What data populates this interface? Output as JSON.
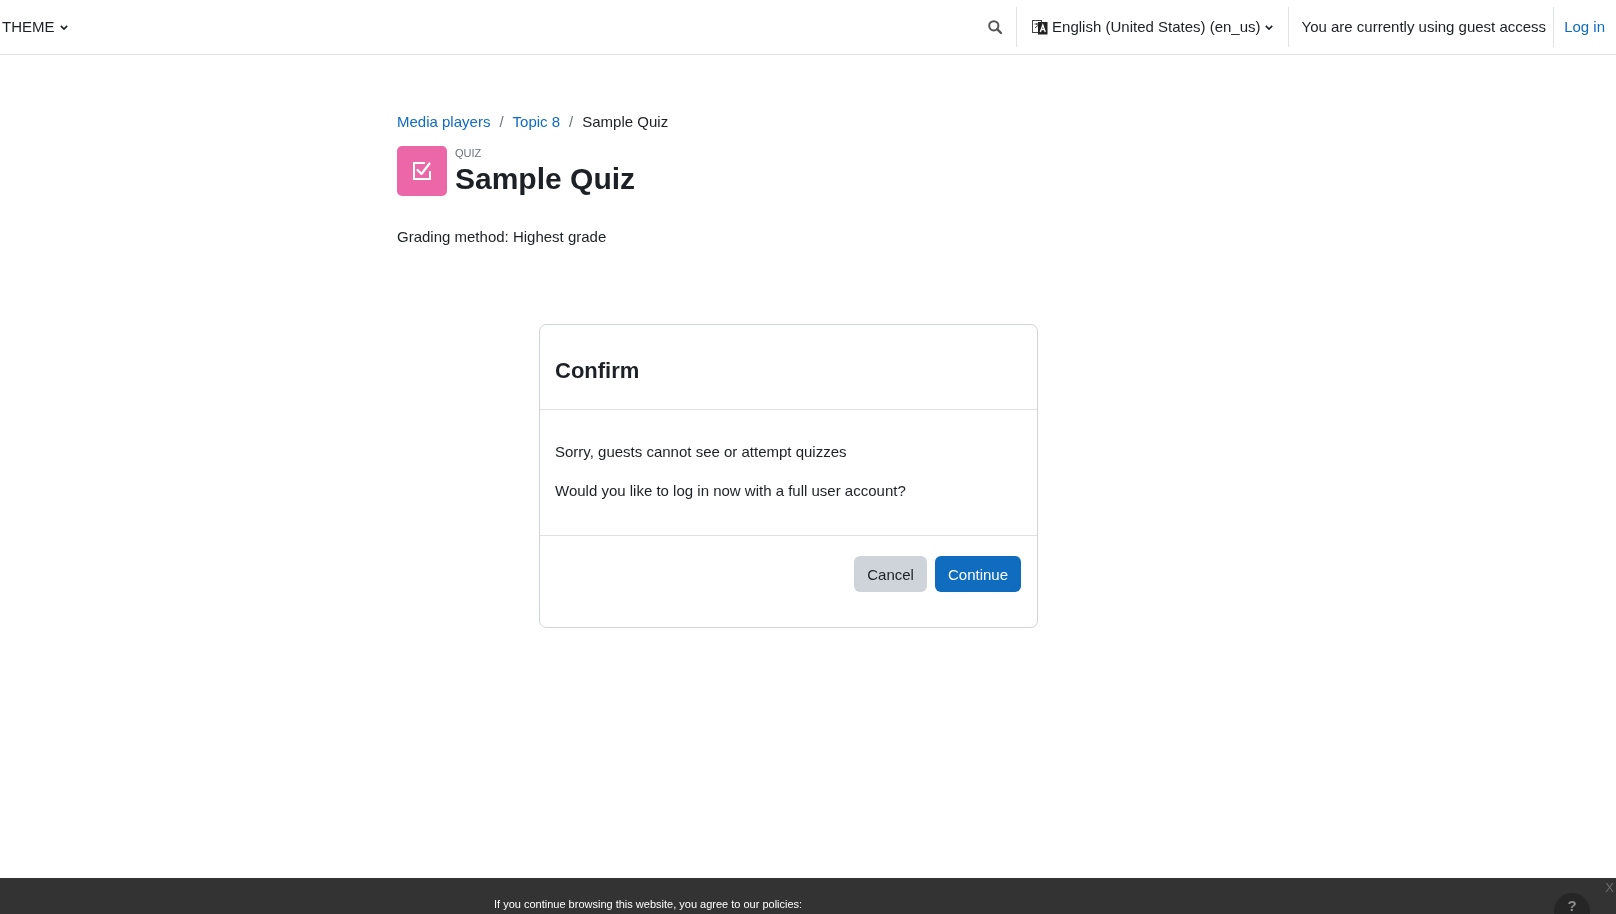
{
  "navbar": {
    "theme_menu": {
      "label": "THEME"
    },
    "language_menu": {
      "label": "English (United States) (en_us)"
    },
    "guest_notice": "You are currently using guest access",
    "login_link": "Log in"
  },
  "breadcrumb": [
    {
      "kind": "link",
      "label": "Media players"
    },
    {
      "kind": "separator",
      "label": "/"
    },
    {
      "kind": "link",
      "label": "Topic 8"
    },
    {
      "kind": "separator",
      "label": "/"
    },
    {
      "kind": "current",
      "label": "Sample Quiz"
    }
  ],
  "page_header": {
    "activity_type": "QUIZ",
    "title": "Sample Quiz"
  },
  "grading_method": "Grading method: Highest grade",
  "dialog": {
    "title": "Confirm",
    "messages": [
      "Sorry, guests cannot see or attempt quizzes",
      "Would you like to log in now with a full user account?"
    ],
    "buttons": [
      {
        "label": "Cancel",
        "kind": "secondary"
      },
      {
        "label": "Continue",
        "kind": "primary"
      }
    ]
  },
  "policy_banner": {
    "text": "If you continue browsing this website, you agree to our policies:",
    "close_label": "X",
    "help_label": "?"
  }
}
